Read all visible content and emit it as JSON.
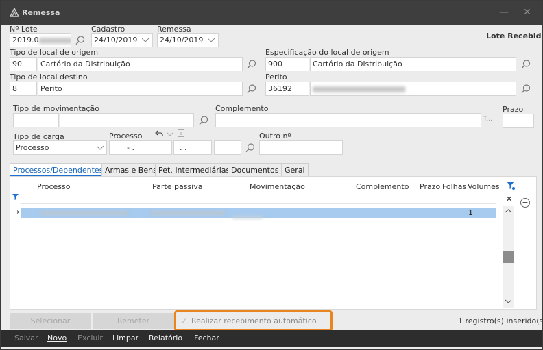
{
  "window": {
    "title": "Remessa",
    "minimize_glyph": "—",
    "close_glyph": "✕"
  },
  "header": {
    "lote_label": "Nº Lote",
    "lote_value": "2019.0",
    "cadastro_label": "Cadastro",
    "cadastro_value": "24/10/2019",
    "remessa_label": "Remessa",
    "remessa_value": "24/10/2019",
    "status": "Lote Recebido"
  },
  "origem": {
    "tipo_label": "Tipo de local de origem",
    "tipo_code": "90",
    "tipo_name": "Cartório da Distribuição",
    "espec_label": "Especificação do local de origem",
    "espec_code": "900",
    "espec_name": "Cartório da Distribuição"
  },
  "destino": {
    "tipo_label": "Tipo de local destino",
    "tipo_code": "8",
    "tipo_name": "Perito",
    "perito_label": "Perito",
    "perito_code": "36192"
  },
  "movimentacao": {
    "tipo_label": "Tipo de movimentação",
    "complemento_label": "Complemento",
    "complemento_suffix": "T...",
    "prazo_label": "Prazo",
    "carga_label": "Tipo de carga",
    "carga_value": "Processo",
    "processo_label": "Processo",
    "processo_value1": "-  .",
    "processo_value2": ".  .",
    "outro_label": "Outro nº"
  },
  "tabs": [
    {
      "label": "Processos/Dependentes",
      "active": true
    },
    {
      "label": "Armas e Bens",
      "active": false
    },
    {
      "label": "Pet. Intermediárias",
      "active": false
    },
    {
      "label": "Documentos",
      "active": false
    },
    {
      "label": "Geral",
      "active": false
    }
  ],
  "grid": {
    "columns": [
      "Processo",
      "Parte passiva",
      "Movimentação",
      "Complemento",
      "Prazo",
      "Folhas",
      "Volumes"
    ],
    "rows": [
      {
        "arrow": "→",
        "volumes": "1"
      }
    ],
    "clear_filter_glyph": "✕",
    "remove_glyph": "−"
  },
  "bottom": {
    "selecionar": "Selecionar",
    "remeter": "Remeter",
    "auto_receive": "Realizar recebimento automático",
    "auto_check": "✓",
    "records": "1 registro(s) inserido(s)"
  },
  "footer": {
    "salvar": "Salvar",
    "novo": "Novo",
    "excluir": "Excluir",
    "limpar": "Limpar",
    "relatorio": "Relatório",
    "fechar": "Fechar"
  },
  "colors": {
    "accent": "#1d6fd0",
    "highlight": "#e8851f",
    "selected_row": "#a6cbef",
    "titlebar": "#3e3e3e"
  }
}
